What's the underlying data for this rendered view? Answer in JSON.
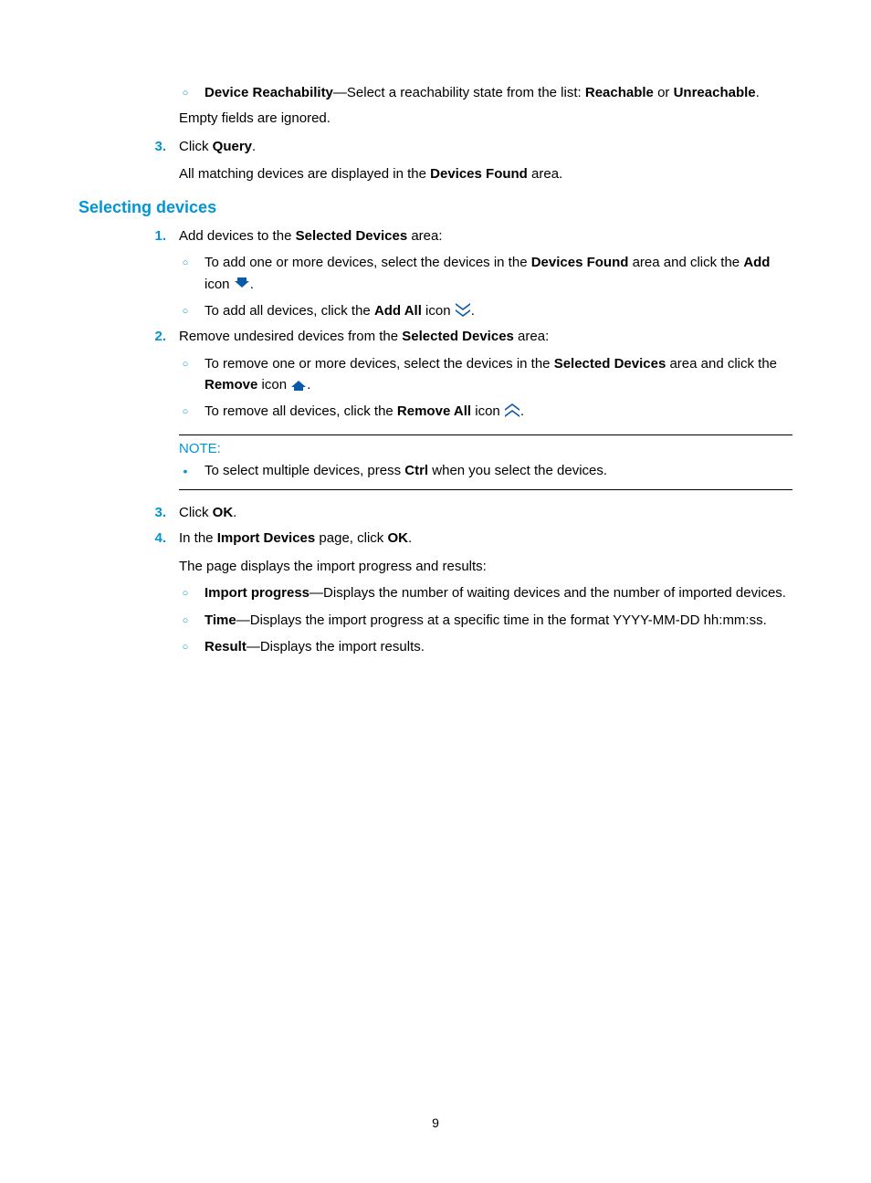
{
  "top": {
    "bullet": {
      "label": "Device Reachability",
      "text": "—Select a reachability state from the list: ",
      "opt1": "Reachable",
      "mid": " or ",
      "opt2": "Unreachable",
      "end": "."
    },
    "empty": "Empty fields are ignored.",
    "step3_num": "3.",
    "step3_a": "Click ",
    "step3_b": "Query",
    "step3_c": ".",
    "step3_sub": "All matching devices are displayed in the ",
    "step3_sub_b": "Devices Found",
    "step3_sub_c": " area."
  },
  "heading": "Selecting devices",
  "sel": {
    "s1_num": "1.",
    "s1_a": "Add devices to the ",
    "s1_b": "Selected Devices",
    "s1_c": " area:",
    "s1_i_a": "To add one or more devices, select the devices in the ",
    "s1_i_b": "Devices Found",
    "s1_i_c": " area and click the ",
    "s1_i_d": "Add",
    "s1_i_e": " icon ",
    "s1_i_f": ".",
    "s1_ii_a": "To add all devices, click the ",
    "s1_ii_b": "Add All",
    "s1_ii_c": " icon ",
    "s1_ii_d": ".",
    "s2_num": "2.",
    "s2_a": "Remove undesired devices from the ",
    "s2_b": "Selected Devices",
    "s2_c": " area:",
    "s2_i_a": "To remove one or more devices, select the devices in the ",
    "s2_i_b": "Selected Devices",
    "s2_i_c": " area and click the ",
    "s2_i_d": "Remove",
    "s2_i_e": " icon ",
    "s2_i_f": ".",
    "s2_ii_a": "To remove all devices, click the ",
    "s2_ii_b": "Remove All",
    "s2_ii_c": " icon ",
    "s2_ii_d": ".",
    "note_title": "NOTE:",
    "note_a": "To select multiple devices, press ",
    "note_b": "Ctrl",
    "note_c": " when you select the devices.",
    "s3_num": "3.",
    "s3_a": "Click ",
    "s3_b": "OK",
    "s3_c": ".",
    "s4_num": "4.",
    "s4_a": "In the ",
    "s4_b": "Import Devices",
    "s4_c": " page, click ",
    "s4_d": "OK",
    "s4_e": ".",
    "s4_sub": "The page displays the import progress and results:",
    "s4_i_b": "Import progress",
    "s4_i_t": "—Displays the number of waiting devices and the number of imported devices.",
    "s4_ii_b": "Time",
    "s4_ii_t": "—Displays the import progress at a specific time in the format YYYY-MM-DD hh:mm:ss.",
    "s4_iii_b": "Result",
    "s4_iii_t": "—Displays the import results."
  },
  "page_number": "9"
}
